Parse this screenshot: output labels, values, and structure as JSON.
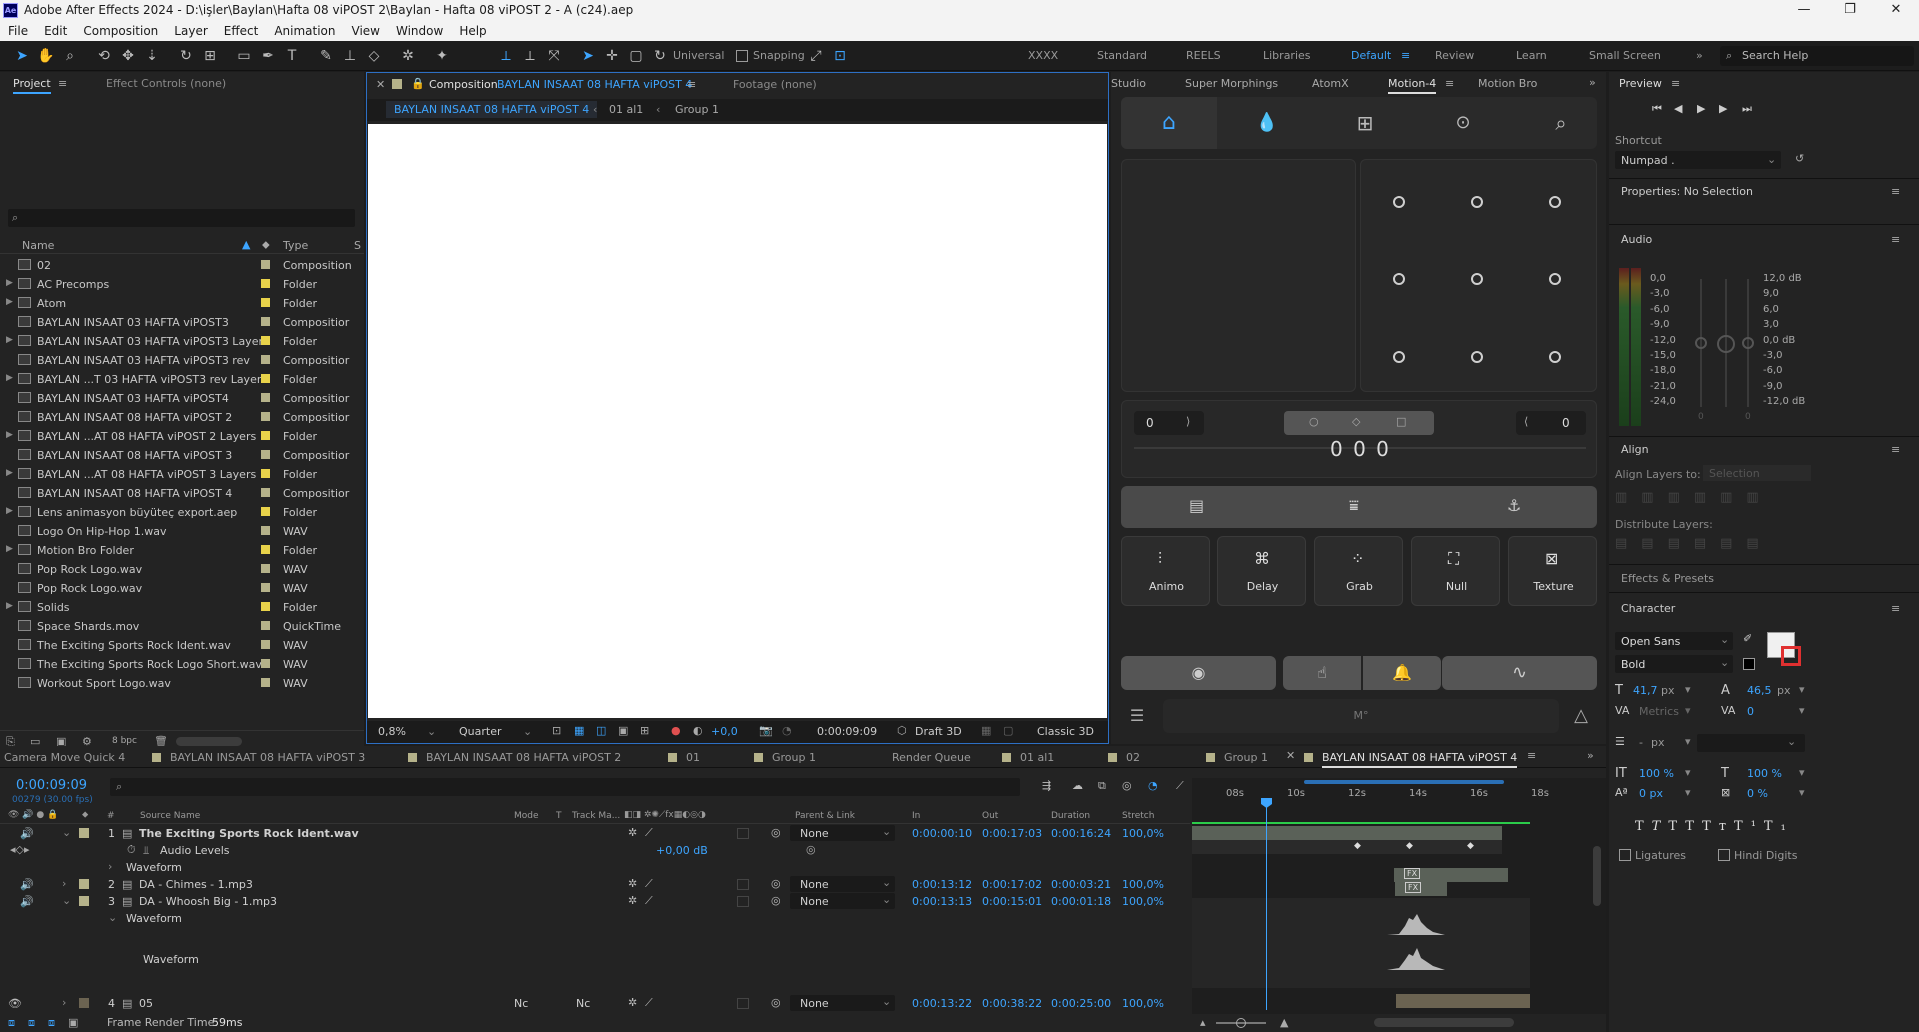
{
  "window": {
    "title": "Adobe After Effects 2024 - D:\\işler\\Baylan\\Hafta 08 viPOST 2\\Baylan - Hafta 08 viPOST 2 - A (c24).aep",
    "app_icon": "Ae"
  },
  "menu": [
    "File",
    "Edit",
    "Composition",
    "Layer",
    "Effect",
    "Animation",
    "View",
    "Window",
    "Help"
  ],
  "toolbar": {
    "universal_label": "Universal",
    "snapping_label": "Snapping",
    "workspaces": [
      "XXXX",
      "Standard",
      "REELS",
      "Libraries",
      "Default",
      "Review",
      "Learn",
      "Small Screen"
    ],
    "active_workspace": "Default",
    "search_placeholder": "Search Help"
  },
  "project_panel": {
    "tab_project": "Project",
    "tab_effect_controls": "Effect Controls (none)",
    "col_name": "Name",
    "col_type": "Type",
    "col_s": "S",
    "bpc": "8 bpc",
    "items": [
      {
        "name": "02",
        "type": "Composition",
        "kind": "comp",
        "color": "#b5b28a",
        "expand": false
      },
      {
        "name": "AC Precomps",
        "type": "Folder",
        "kind": "folder",
        "color": "#e8d24a",
        "expand": true
      },
      {
        "name": "Atom",
        "type": "Folder",
        "kind": "folder",
        "color": "#e8d24a",
        "expand": true
      },
      {
        "name": "BAYLAN INSAAT 03 HAFTA viPOST3",
        "type": "Compositior",
        "kind": "comp",
        "color": "#b5b28a",
        "expand": false
      },
      {
        "name": "BAYLAN INSAAT 03 HAFTA viPOST3 Layers",
        "type": "Folder",
        "kind": "folder",
        "color": "#e8d24a",
        "expand": true
      },
      {
        "name": "BAYLAN INSAAT 03 HAFTA viPOST3 rev",
        "type": "Compositior",
        "kind": "comp",
        "color": "#b5b28a",
        "expand": false
      },
      {
        "name": "BAYLAN ...T 03 HAFTA viPOST3 rev Layers",
        "type": "Folder",
        "kind": "folder",
        "color": "#e8d24a",
        "expand": true
      },
      {
        "name": "BAYLAN INSAAT 03 HAFTA viPOST4",
        "type": "Compositior",
        "kind": "comp",
        "color": "#b5b28a",
        "expand": false
      },
      {
        "name": "BAYLAN INSAAT 08 HAFTA viPOST 2",
        "type": "Compositior",
        "kind": "comp",
        "color": "#b5b28a",
        "expand": false
      },
      {
        "name": "BAYLAN ...AT 08 HAFTA viPOST 2 Layers",
        "type": "Folder",
        "kind": "folder",
        "color": "#e8d24a",
        "expand": true
      },
      {
        "name": "BAYLAN INSAAT 08 HAFTA viPOST 3",
        "type": "Compositior",
        "kind": "comp",
        "color": "#b5b28a",
        "expand": false
      },
      {
        "name": "BAYLAN ...AT 08 HAFTA viPOST 3 Layers",
        "type": "Folder",
        "kind": "folder",
        "color": "#e8d24a",
        "expand": true
      },
      {
        "name": "BAYLAN INSAAT 08 HAFTA viPOST 4",
        "type": "Compositior",
        "kind": "comp",
        "color": "#b5b28a",
        "expand": false
      },
      {
        "name": "Lens animasyon büyüteç export.aep",
        "type": "Folder",
        "kind": "folder",
        "color": "#e8d24a",
        "expand": true
      },
      {
        "name": "Logo On Hip-Hop 1.wav",
        "type": "WAV",
        "kind": "audio",
        "color": "#b5b28a",
        "expand": false
      },
      {
        "name": "Motion Bro Folder",
        "type": "Folder",
        "kind": "folder",
        "color": "#e8d24a",
        "expand": true
      },
      {
        "name": "Pop Rock Logo.wav",
        "type": "WAV",
        "kind": "audio",
        "color": "#b5b28a",
        "expand": false
      },
      {
        "name": "Pop Rock Logo.wav",
        "type": "WAV",
        "kind": "audio",
        "color": "#b5b28a",
        "expand": false
      },
      {
        "name": "Solids",
        "type": "Folder",
        "kind": "folder",
        "color": "#e8d24a",
        "expand": true
      },
      {
        "name": "Space Shards.mov",
        "type": "QuickTime",
        "kind": "audio",
        "color": "#b5b28a",
        "expand": false
      },
      {
        "name": "The Exciting Sports Rock Ident.wav",
        "type": "WAV",
        "kind": "audio",
        "color": "#b5b28a",
        "expand": false
      },
      {
        "name": "The Exciting Sports Rock Logo Short.wav",
        "type": "WAV",
        "kind": "audio",
        "color": "#b5b28a",
        "expand": false
      },
      {
        "name": "Workout Sport Logo.wav",
        "type": "WAV",
        "kind": "audio",
        "color": "#b5b28a",
        "expand": false
      }
    ]
  },
  "composition": {
    "tab_label": "Composition",
    "comp_name": "BAYLAN INSAAT 08 HAFTA viPOST 4",
    "footage_tab": "Footage (none)",
    "breadcrumbs": [
      "BAYLAN INSAAT 08 HAFTA viPOST 4",
      "01 al1",
      "Group 1"
    ],
    "zoom": "0,8%",
    "resolution": "Quarter",
    "exposure": "+0,0",
    "timecode": "0:00:09:09",
    "draft3d": "Draft 3D",
    "renderer": "Classic 3D"
  },
  "motion_panel": {
    "tabs": [
      "Studio",
      "Super Morphings",
      "AtomX",
      "Motion-4",
      "Motion Bro"
    ],
    "active_tab": "Motion-4",
    "left_value": "0",
    "right_value": "0",
    "center_value": "0 0 0",
    "buttons": [
      "Animo",
      "Delay",
      "Grab",
      "Null",
      "Texture"
    ],
    "m_label": "M°"
  },
  "preview": {
    "title": "Preview",
    "shortcut_label": "Shortcut",
    "shortcut_value": "Numpad ."
  },
  "properties": {
    "title": "Properties: No Selection"
  },
  "audio": {
    "title": "Audio",
    "left_scale": [
      "0,0",
      "-3,0",
      "-6,0",
      "-9,0",
      "-12,0",
      "-15,0",
      "-18,0",
      "-21,0",
      "-24,0"
    ],
    "right_scale": [
      "12,0 dB",
      "9,0",
      "6,0",
      "3,0",
      "0,0 dB",
      "-3,0",
      "-6,0",
      "-9,0",
      "-12,0 dB"
    ],
    "zero_left": "0",
    "zero_right": "0"
  },
  "align": {
    "title": "Align",
    "align_layers_to": "Align Layers to:",
    "selection": "Selection",
    "distribute": "Distribute Layers:"
  },
  "effects_presets": {
    "title": "Effects & Presets"
  },
  "character": {
    "title": "Character",
    "font": "Open Sans",
    "style": "Bold",
    "size": "41,7",
    "size_unit": "px",
    "leading": "46,5",
    "leading_unit": "px",
    "kerning": "Metrics",
    "tracking": "0",
    "stroke": "-",
    "stroke_unit": "px",
    "vscale": "100 %",
    "hscale": "100 %",
    "baseline": "0 px",
    "tsume": "0 %",
    "ligatures": "Ligatures",
    "hindi": "Hindi Digits",
    "fill_color": "#f0f0f0",
    "stroke_color": "#000000"
  },
  "timeline": {
    "tabs": [
      "Camera Move Quick 4",
      "BAYLAN INSAAT 08 HAFTA viPOST 3",
      "BAYLAN INSAAT 08 HAFTA viPOST 2",
      "01",
      "Group 1",
      "Render Queue",
      "01 al1",
      "02",
      "Group 1",
      "BAYLAN INSAAT 08 HAFTA viPOST 4"
    ],
    "current_time": "0:00:09:09",
    "frame_info": "00279 (30.00 fps)",
    "columns": {
      "num": "#",
      "source": "Source Name",
      "mode": "Mode",
      "t": "T",
      "trackmatte": "Track Ma...",
      "parent": "Parent & Link",
      "in": "In",
      "out": "Out",
      "duration": "Duration",
      "stretch": "Stretch"
    },
    "ruler": [
      "08s",
      "10s",
      "12s",
      "14s",
      "16s",
      "18s"
    ],
    "layers": [
      {
        "num": "1",
        "name": "The Exciting Sports Rock Ident.wav",
        "parent": "None",
        "in": "0:00:00:10",
        "out": "0:00:17:03",
        "duration": "0:00:16:24",
        "stretch": "100,0%"
      },
      {
        "num": "2",
        "name": "DA - Chimes - 1.mp3",
        "parent": "None",
        "in": "0:00:13:12",
        "out": "0:00:17:02",
        "duration": "0:00:03:21",
        "stretch": "100,0%"
      },
      {
        "num": "3",
        "name": "DA - Whoosh Big - 1.mp3",
        "parent": "None",
        "in": "0:00:13:13",
        "out": "0:00:15:01",
        "duration": "0:00:01:18",
        "stretch": "100,0%"
      },
      {
        "num": "4",
        "name": "05",
        "parent": "None",
        "in": "0:00:13:22",
        "out": "0:00:38:22",
        "duration": "0:00:25:00",
        "stretch": "100,0%",
        "mode": "Nc",
        "track": "Nc"
      }
    ],
    "audio_levels_label": "Audio Levels",
    "audio_levels_value": "+0,00 dB",
    "waveform_label": "Waveform",
    "render_time_label": "Frame Render Time:",
    "render_time_value": "59ms"
  }
}
